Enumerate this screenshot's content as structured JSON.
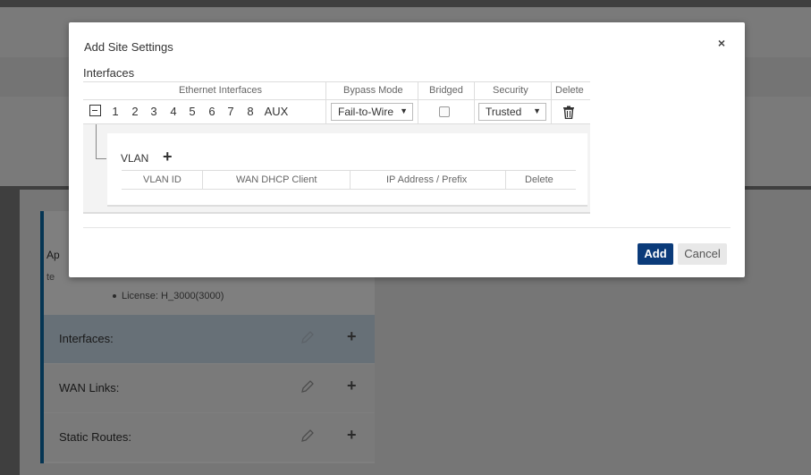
{
  "background": {
    "app_label_partial": "Ap",
    "te_label_partial": "te",
    "license_text": "License: H_3000(3000)",
    "rows": [
      {
        "label": "Interfaces:",
        "edit_icon": "pencil-icon",
        "add_icon": "plus-icon"
      },
      {
        "label": "WAN Links:",
        "edit_icon": "pencil-icon",
        "add_icon": "plus-icon"
      },
      {
        "label": "Static Routes:",
        "edit_icon": "pencil-icon",
        "add_icon": "plus-icon"
      }
    ],
    "add_symbol": "+",
    "accent_color": "#0a6aa6",
    "selected_row_color": "#cfe0ef"
  },
  "modal": {
    "title": "Add Site Settings",
    "close_symbol": "×",
    "section_label": "Interfaces",
    "columns": {
      "ethernet": "Ethernet Interfaces",
      "bypass": "Bypass Mode",
      "bridged": "Bridged",
      "security": "Security",
      "delete": "Delete"
    },
    "row": {
      "ports": [
        "1",
        "2",
        "3",
        "4",
        "5",
        "6",
        "7",
        "8",
        "AUX"
      ],
      "bypass_mode": "Fail-to-Wire",
      "bridged_checked": false,
      "security": "Trusted",
      "dropdown_arrow": "▼"
    },
    "vlan": {
      "label": "VLAN",
      "add_symbol": "+",
      "columns": {
        "vlan_id": "VLAN ID",
        "wan_dhcp": "WAN DHCP Client",
        "ip_prefix": "IP Address / Prefix",
        "delete": "Delete"
      }
    },
    "buttons": {
      "add": "Add",
      "cancel": "Cancel"
    },
    "primary_color": "#0b3b7a"
  }
}
